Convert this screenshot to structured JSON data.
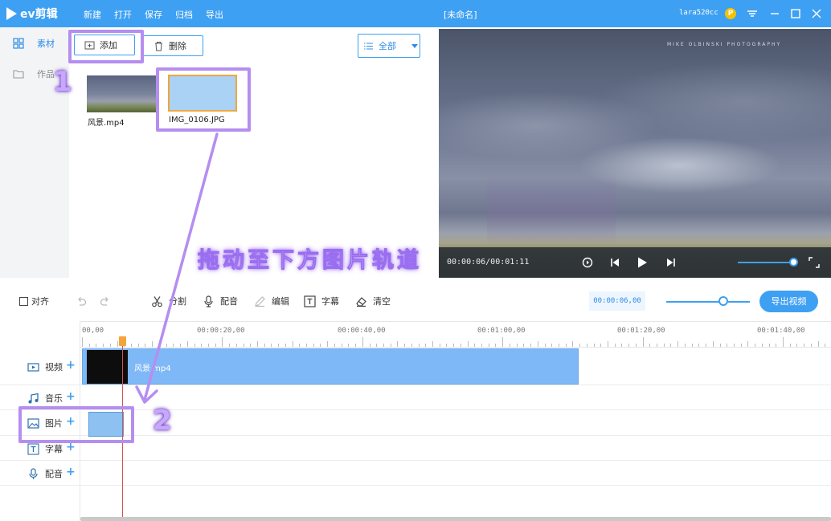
{
  "app": {
    "logo": "ev剪辑",
    "menu": [
      "新建",
      "打开",
      "保存",
      "归档",
      "导出"
    ],
    "doc_title": "[未命名]",
    "user": "lara520cc",
    "vip_badge": "P"
  },
  "sidebar": {
    "items": [
      {
        "label": "素材",
        "icon": "grid-icon",
        "active": true
      },
      {
        "label": "作品",
        "icon": "folder-icon",
        "active": false
      }
    ]
  },
  "media_toolbar": {
    "add_label": "添加",
    "delete_label": "删除",
    "filter_label": "全部"
  },
  "media_items": [
    {
      "name": "风景.mp4",
      "type": "video"
    },
    {
      "name": "IMG_0106.JPG",
      "type": "image"
    }
  ],
  "preview": {
    "watermark": "MIKE OLBINSKI PHOTOGRAPHY",
    "timecode": "00:00:06/00:01:11"
  },
  "timeline_toolbar": {
    "align_label": "对齐",
    "split_label": "分割",
    "dub_label": "配音",
    "edit_label": "编辑",
    "subtitle_label": "字幕",
    "clear_label": "清空",
    "current_time": "00:00:06,00",
    "export_label": "导出视频"
  },
  "ruler": {
    "labels": [
      "00,00",
      "00:00:20,00",
      "00:00:40,00",
      "00:01:00,00",
      "00:01:20,00",
      "00:01:40,00"
    ]
  },
  "tracks": [
    {
      "label": "视频",
      "icon": "video-track-icon"
    },
    {
      "label": "音乐",
      "icon": "music-note-icon"
    },
    {
      "label": "图片",
      "icon": "image-icon"
    },
    {
      "label": "字幕",
      "icon": "text-icon"
    },
    {
      "label": "配音",
      "icon": "microphone-icon"
    }
  ],
  "clips": {
    "video_clip_label": "风景.mp4"
  },
  "annotations": {
    "step1": "1",
    "step2": "2",
    "caption": "拖动至下方图片轨道"
  },
  "colors": {
    "accent": "#3ea0f2",
    "highlight": "#b58ef0",
    "clip": "#7fb8f6",
    "playhead": "#d9534f"
  }
}
